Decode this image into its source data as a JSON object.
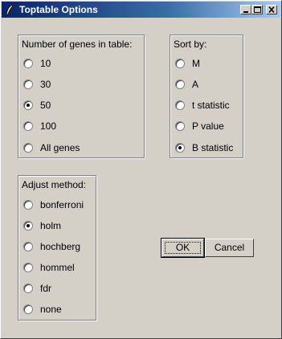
{
  "window": {
    "title": "Toptable Options"
  },
  "genes_group": {
    "title": "Number of genes in table:",
    "options": [
      {
        "label": "10",
        "selected": false
      },
      {
        "label": "30",
        "selected": false
      },
      {
        "label": "50",
        "selected": true
      },
      {
        "label": "100",
        "selected": false
      },
      {
        "label": "All genes",
        "selected": false
      }
    ]
  },
  "sort_group": {
    "title": "Sort by:",
    "options": [
      {
        "label": "M",
        "selected": false
      },
      {
        "label": "A",
        "selected": false
      },
      {
        "label": "t statistic",
        "selected": false
      },
      {
        "label": "P value",
        "selected": false
      },
      {
        "label": "B statistic",
        "selected": true
      }
    ]
  },
  "adjust_group": {
    "title": "Adjust method:",
    "options": [
      {
        "label": "bonferroni",
        "selected": false
      },
      {
        "label": "holm",
        "selected": true
      },
      {
        "label": "hochberg",
        "selected": false
      },
      {
        "label": "hommel",
        "selected": false
      },
      {
        "label": "fdr",
        "selected": false
      },
      {
        "label": "none",
        "selected": false
      }
    ]
  },
  "buttons": {
    "ok": "OK",
    "cancel": "Cancel"
  }
}
